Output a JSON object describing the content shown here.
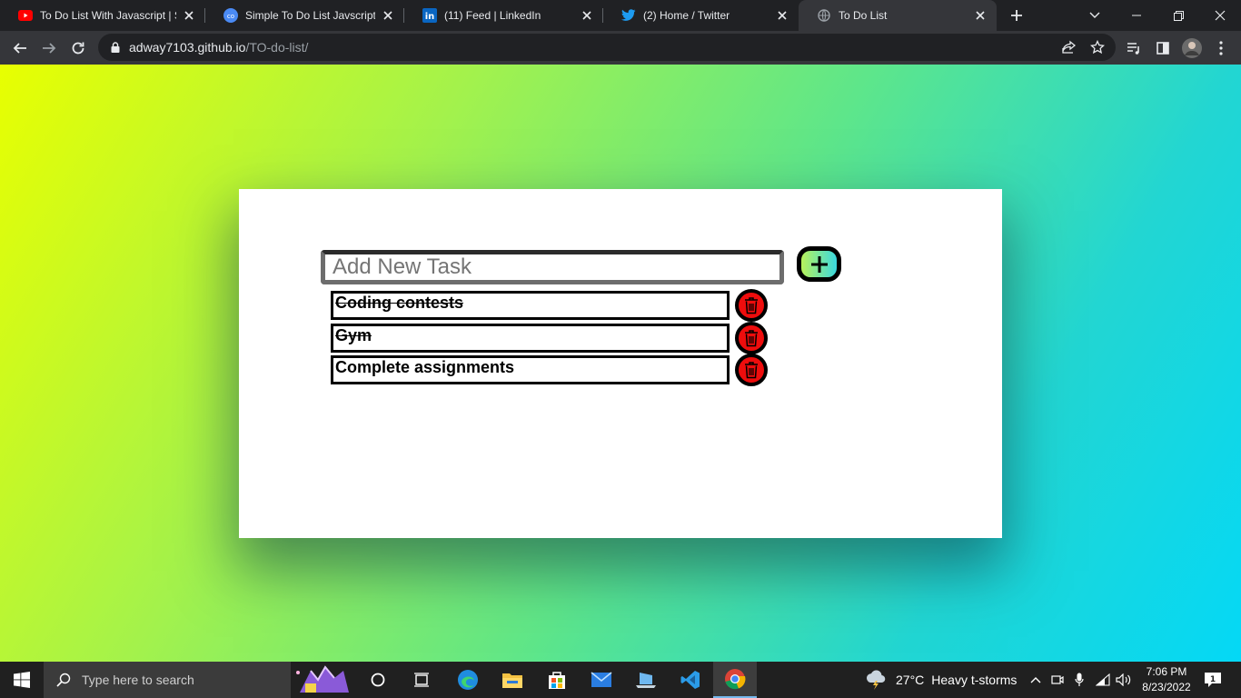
{
  "browser": {
    "tabs": [
      {
        "title": "To Do List With Javascript | St",
        "favicon": "youtube-icon"
      },
      {
        "title": "Simple To Do List Javscript | J",
        "favicon": "codepen-icon"
      },
      {
        "title": "(11) Feed | LinkedIn",
        "favicon": "linkedin-icon"
      },
      {
        "title": "(2) Home / Twitter",
        "favicon": "twitter-icon"
      },
      {
        "title": "To Do List",
        "favicon": "globe-icon",
        "active": true
      }
    ],
    "address": {
      "host": "adway7103.github.io",
      "path": "/TO-do-list/"
    }
  },
  "app": {
    "input": {
      "placeholder": "Add New Task",
      "value": ""
    },
    "add_button_icon": "plus-icon",
    "tasks": [
      {
        "text": "Coding contests",
        "done": true
      },
      {
        "text": "Gym",
        "done": true
      },
      {
        "text": "Complete assignments",
        "done": false
      }
    ],
    "delete_button_icon": "trash-icon",
    "colors": {
      "delete": "#ee0d0d",
      "card": "#ffffff",
      "gradient_start": "#e8ff00",
      "gradient_end": "#04d8f6"
    }
  },
  "taskbar": {
    "search_placeholder": "Type here to search",
    "weather": {
      "temp": "27°C",
      "condition": "Heavy t-storms"
    },
    "time": "7:06 PM",
    "date": "8/23/2022",
    "notification_count": "1"
  }
}
